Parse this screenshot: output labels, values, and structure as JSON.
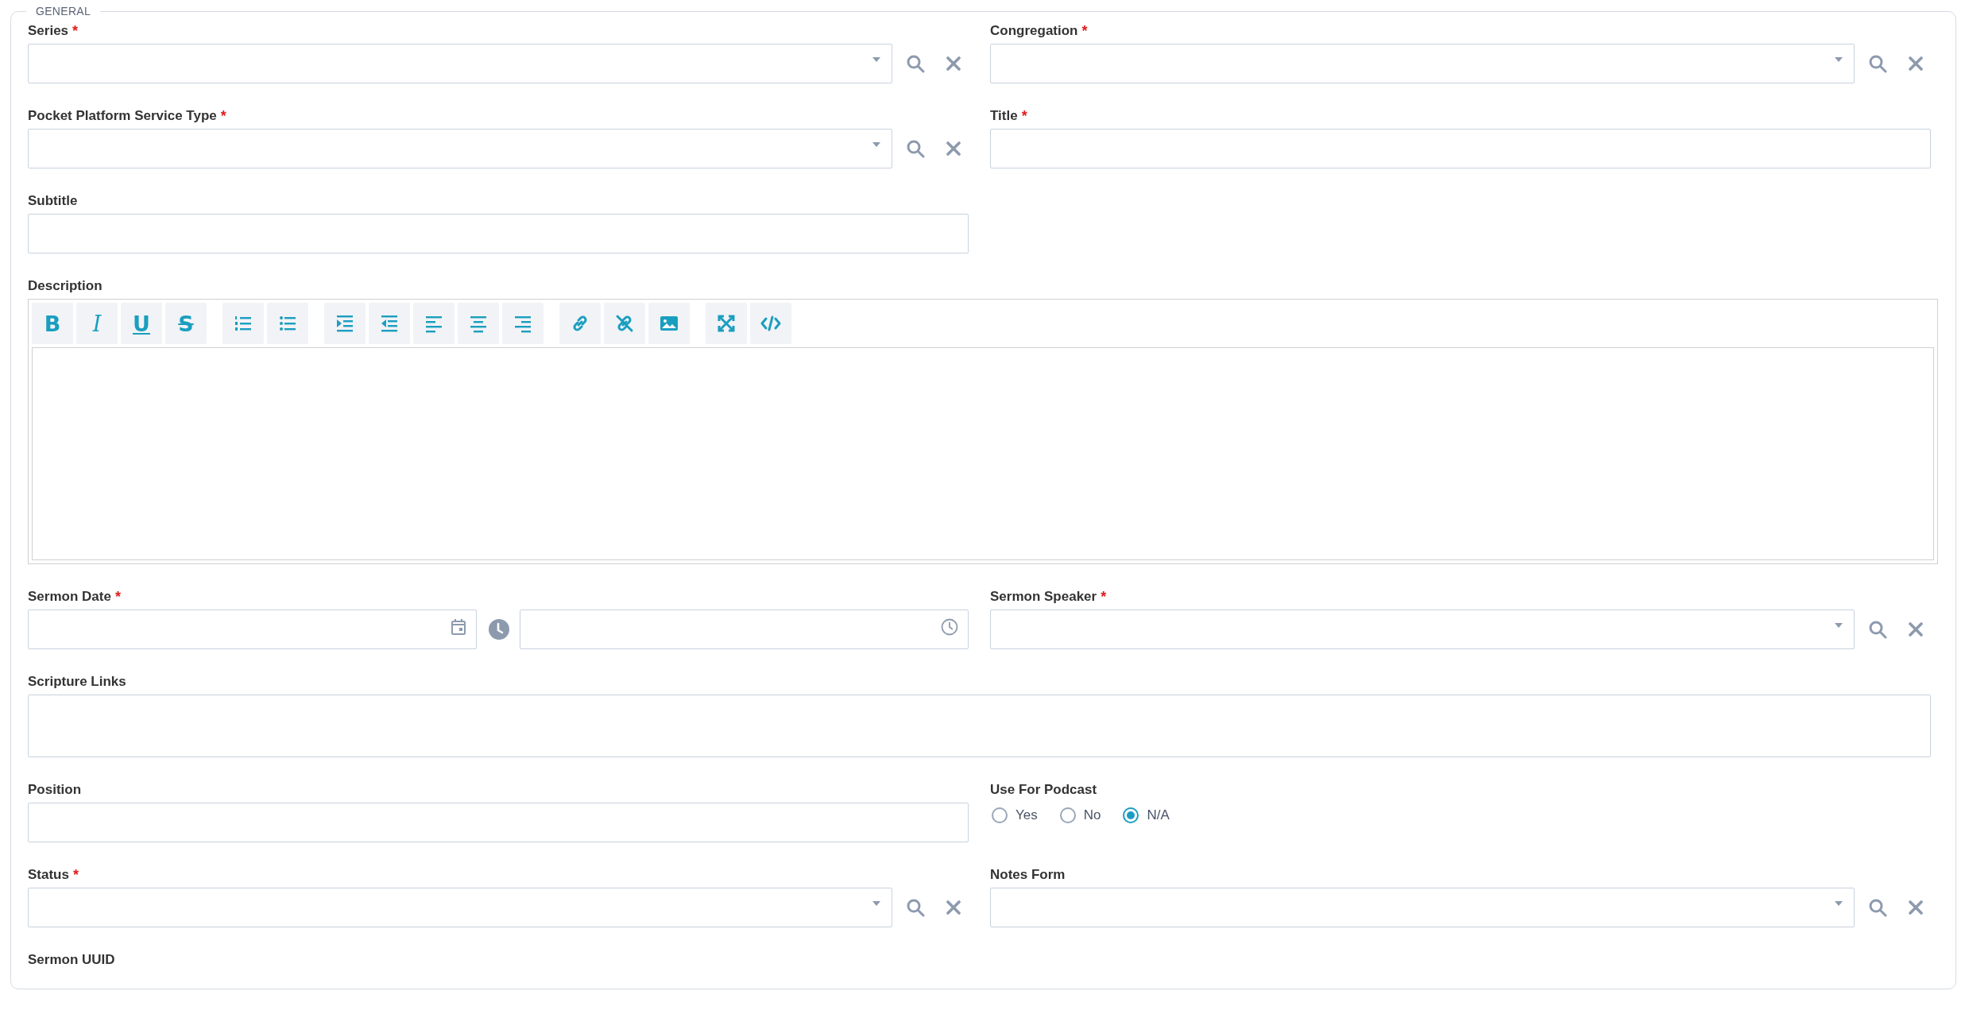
{
  "section": {
    "legend": "GENERAL"
  },
  "rows": [
    {
      "fields": [
        {
          "kind": "lookup-select",
          "label": "Series",
          "required_mark": "*"
        },
        {
          "kind": "lookup-select",
          "label": "Congregation",
          "required_mark": "*"
        }
      ]
    },
    {
      "fields": [
        {
          "kind": "lookup-select",
          "label": "Pocket Platform Service Type",
          "required_mark": "*"
        },
        {
          "kind": "text",
          "label": "Title",
          "required_mark": "*"
        }
      ]
    },
    {
      "fields": [
        {
          "kind": "text",
          "label": "Subtitle"
        }
      ]
    },
    {
      "fields": [
        {
          "kind": "editor",
          "label": "Description",
          "toolbar": [
            [
              {
                "kind": "bold",
                "glyph": "B"
              },
              {
                "kind": "italic",
                "glyph": "I"
              },
              {
                "kind": "underline",
                "glyph": "U"
              },
              {
                "kind": "strike",
                "glyph": "S"
              }
            ],
            [
              {
                "kind": "ordered-list"
              },
              {
                "kind": "bullet-list"
              }
            ],
            [
              {
                "kind": "indent"
              },
              {
                "kind": "outdent"
              },
              {
                "kind": "align-left"
              },
              {
                "kind": "align-center"
              },
              {
                "kind": "align-right"
              }
            ],
            [
              {
                "kind": "link"
              },
              {
                "kind": "unlink"
              },
              {
                "kind": "image"
              }
            ],
            [
              {
                "kind": "fullscreen"
              },
              {
                "kind": "code"
              }
            ]
          ]
        }
      ]
    },
    {
      "fields": [
        {
          "kind": "datetime",
          "label": "Sermon Date",
          "required_mark": "*"
        },
        {
          "kind": "lookup-select",
          "label": "Sermon Speaker",
          "required_mark": "*"
        }
      ]
    },
    {
      "fields": [
        {
          "kind": "textarea",
          "label": "Scripture Links"
        }
      ]
    },
    {
      "fields": [
        {
          "kind": "text",
          "label": "Position"
        },
        {
          "kind": "radio",
          "label": "Use For Podcast",
          "options": [
            {
              "label": "Yes",
              "selected": false
            },
            {
              "label": "No",
              "selected": false
            },
            {
              "label": "N/A",
              "selected": true
            }
          ]
        }
      ]
    },
    {
      "fields": [
        {
          "kind": "lookup-select",
          "label": "Status",
          "required_mark": "*"
        },
        {
          "kind": "lookup-select",
          "label": "Notes Form"
        }
      ]
    },
    {
      "fields": [
        {
          "kind": "display",
          "label": "Sermon UUID"
        }
      ]
    }
  ]
}
